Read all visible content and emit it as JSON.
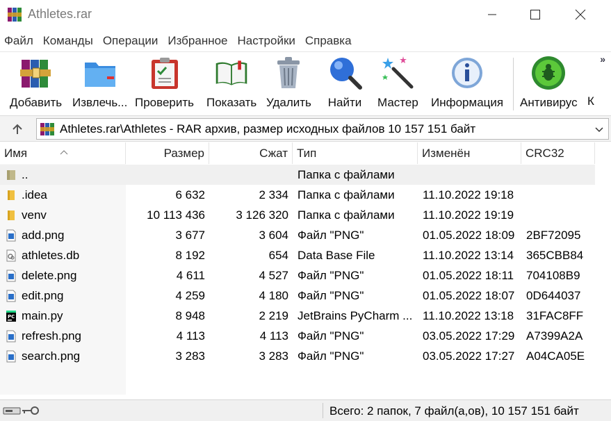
{
  "window": {
    "title": "Athletes.rar",
    "minimize_icon": "minimize-icon",
    "maximize_icon": "maximize-icon",
    "close_icon": "close-icon"
  },
  "menu": [
    "Файл",
    "Команды",
    "Операции",
    "Избранное",
    "Настройки",
    "Справка"
  ],
  "toolbar": {
    "buttons": [
      {
        "label": "Добавить",
        "icon": "add-archive-icon"
      },
      {
        "label": "Извлечь...",
        "icon": "extract-folder-icon"
      },
      {
        "label": "Проверить",
        "icon": "test-clipboard-icon"
      },
      {
        "label": "Показать",
        "icon": "view-book-icon"
      },
      {
        "label": "Удалить",
        "icon": "trash-icon"
      },
      {
        "label": "Найти",
        "icon": "magnifier-icon"
      },
      {
        "label": "Мастер",
        "icon": "wizard-wand-icon"
      },
      {
        "label": "Информация",
        "icon": "info-icon"
      },
      {
        "label": "Антивирус",
        "icon": "antivirus-bug-icon"
      }
    ],
    "overflow_cut_label": "К",
    "more_glyph": "»"
  },
  "address": {
    "path": "Athletes.rar\\Athletes - RAR архив, размер исходных файлов 10 157 151 байт",
    "up_icon": "up-arrow-icon",
    "dropdown_icon": "chevron-down-icon"
  },
  "columns": {
    "name": "Имя",
    "size": "Размер",
    "packed": "Сжат",
    "type": "Тип",
    "modified": "Изменён",
    "crc": "CRC32"
  },
  "files": [
    {
      "name": "..",
      "size": "",
      "packed": "",
      "type": "Папка с файлами",
      "modified": "",
      "crc": "",
      "icon": "parent-folder-icon"
    },
    {
      "name": ".idea",
      "size": "6 632",
      "packed": "2 334",
      "type": "Папка с файлами",
      "modified": "11.10.2022 19:18",
      "crc": "",
      "icon": "folder-icon"
    },
    {
      "name": "venv",
      "size": "10 113 436",
      "packed": "3 126 320",
      "type": "Папка с файлами",
      "modified": "11.10.2022 19:19",
      "crc": "",
      "icon": "folder-icon"
    },
    {
      "name": "add.png",
      "size": "3 677",
      "packed": "3 604",
      "type": "Файл \"PNG\"",
      "modified": "01.05.2022 18:09",
      "crc": "2BF72095",
      "icon": "image-file-icon"
    },
    {
      "name": "athletes.db",
      "size": "8 192",
      "packed": "654",
      "type": "Data Base File",
      "modified": "11.10.2022 13:14",
      "crc": "365CBB84",
      "icon": "database-file-icon"
    },
    {
      "name": "delete.png",
      "size": "4 611",
      "packed": "4 527",
      "type": "Файл \"PNG\"",
      "modified": "01.05.2022 18:11",
      "crc": "704108B9",
      "icon": "image-file-icon"
    },
    {
      "name": "edit.png",
      "size": "4 259",
      "packed": "4 180",
      "type": "Файл \"PNG\"",
      "modified": "01.05.2022 18:07",
      "crc": "0D644037",
      "icon": "image-file-icon"
    },
    {
      "name": "main.py",
      "size": "8 948",
      "packed": "2 219",
      "type": "JetBrains PyCharm ...",
      "modified": "11.10.2022 13:18",
      "crc": "31FAC8FF",
      "icon": "pycharm-file-icon"
    },
    {
      "name": "refresh.png",
      "size": "4 113",
      "packed": "4 113",
      "type": "Файл \"PNG\"",
      "modified": "03.05.2022 17:29",
      "crc": "A7399A2A",
      "icon": "image-file-icon"
    },
    {
      "name": "search.png",
      "size": "3 283",
      "packed": "3 283",
      "type": "Файл \"PNG\"",
      "modified": "03.05.2022 17:27",
      "crc": "A04CA05E",
      "icon": "image-file-icon"
    }
  ],
  "status": {
    "text": "Всего: 2 папок, 7 файл(а,ов), 10 157 151 байт",
    "icons": [
      "drive-icon",
      "key-icon"
    ]
  }
}
